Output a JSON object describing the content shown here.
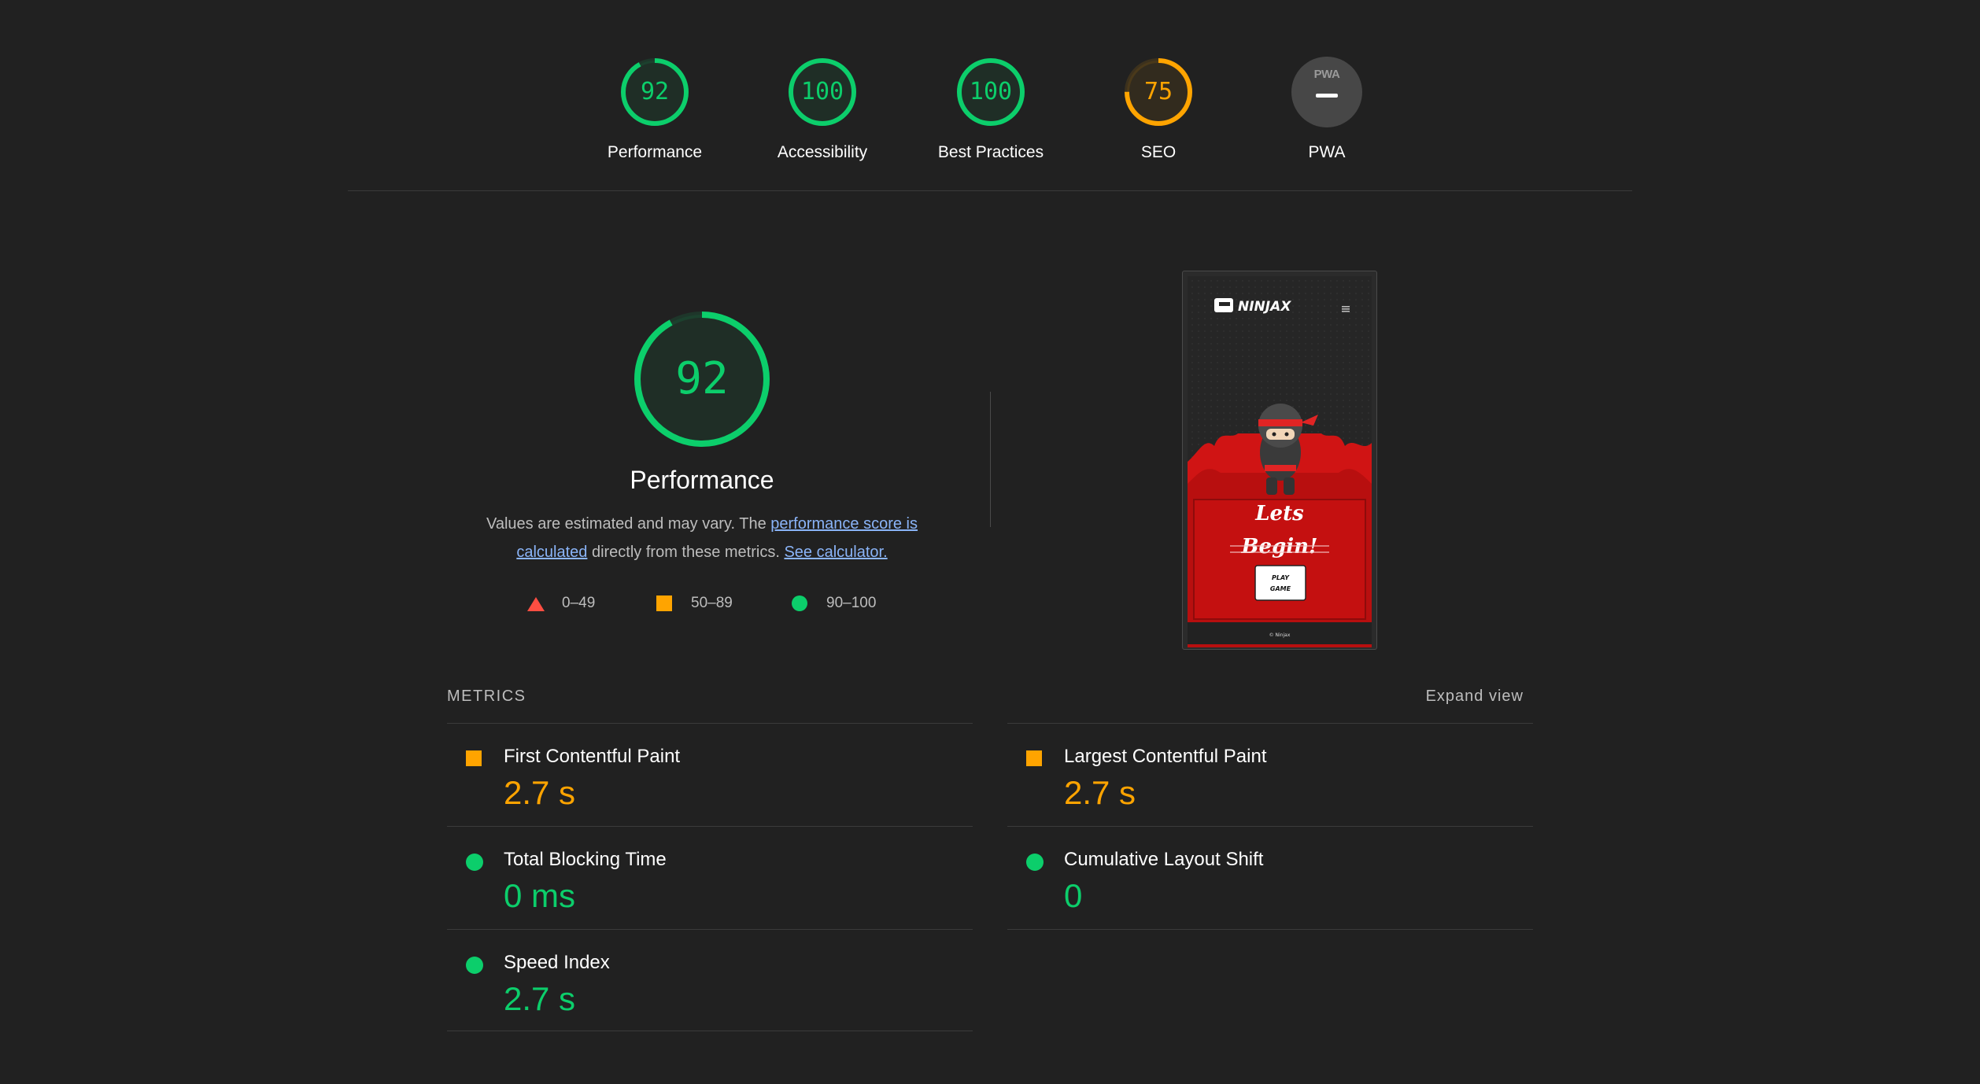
{
  "colors": {
    "pass": "#0cce6b",
    "average": "#ffa400",
    "fail": "#ff4e42",
    "background": "#212121"
  },
  "categories": [
    {
      "label": "Performance",
      "score": 92,
      "color": "#0cce6b"
    },
    {
      "label": "Accessibility",
      "score": 100,
      "color": "#0cce6b"
    },
    {
      "label": "Best Practices",
      "score": 100,
      "color": "#0cce6b"
    },
    {
      "label": "SEO",
      "score": 75,
      "color": "#ffa400"
    },
    {
      "label": "PWA",
      "badge_text": "PWA",
      "icon": "pwa-badge-icon"
    }
  ],
  "performance": {
    "score": 92,
    "title": "Performance",
    "desc_prefix": "Values are estimated and may vary. The ",
    "desc_link1": "performance score is calculated",
    "desc_middle": " directly from these metrics. ",
    "desc_link2": "See calculator."
  },
  "legend": [
    {
      "range": "0–49",
      "icon": "fail-triangle-icon"
    },
    {
      "range": "50–89",
      "icon": "average-square-icon"
    },
    {
      "range": "90–100",
      "icon": "pass-circle-icon"
    }
  ],
  "screenshot": {
    "brand": "NINJAX",
    "headline_1": "Lets",
    "headline_2": "Begin!",
    "button_line_1": "PLAY",
    "button_line_2": "GAME",
    "footer": "© Ninjax"
  },
  "metrics": {
    "header": "METRICS",
    "expand_label": "Expand view",
    "items": [
      {
        "title": "First Contentful Paint",
        "value": "2.7 s",
        "status": "average"
      },
      {
        "title": "Largest Contentful Paint",
        "value": "2.7 s",
        "status": "average"
      },
      {
        "title": "Total Blocking Time",
        "value": "0 ms",
        "status": "pass"
      },
      {
        "title": "Cumulative Layout Shift",
        "value": "0",
        "status": "pass"
      },
      {
        "title": "Speed Index",
        "value": "2.7 s",
        "status": "pass"
      }
    ]
  }
}
